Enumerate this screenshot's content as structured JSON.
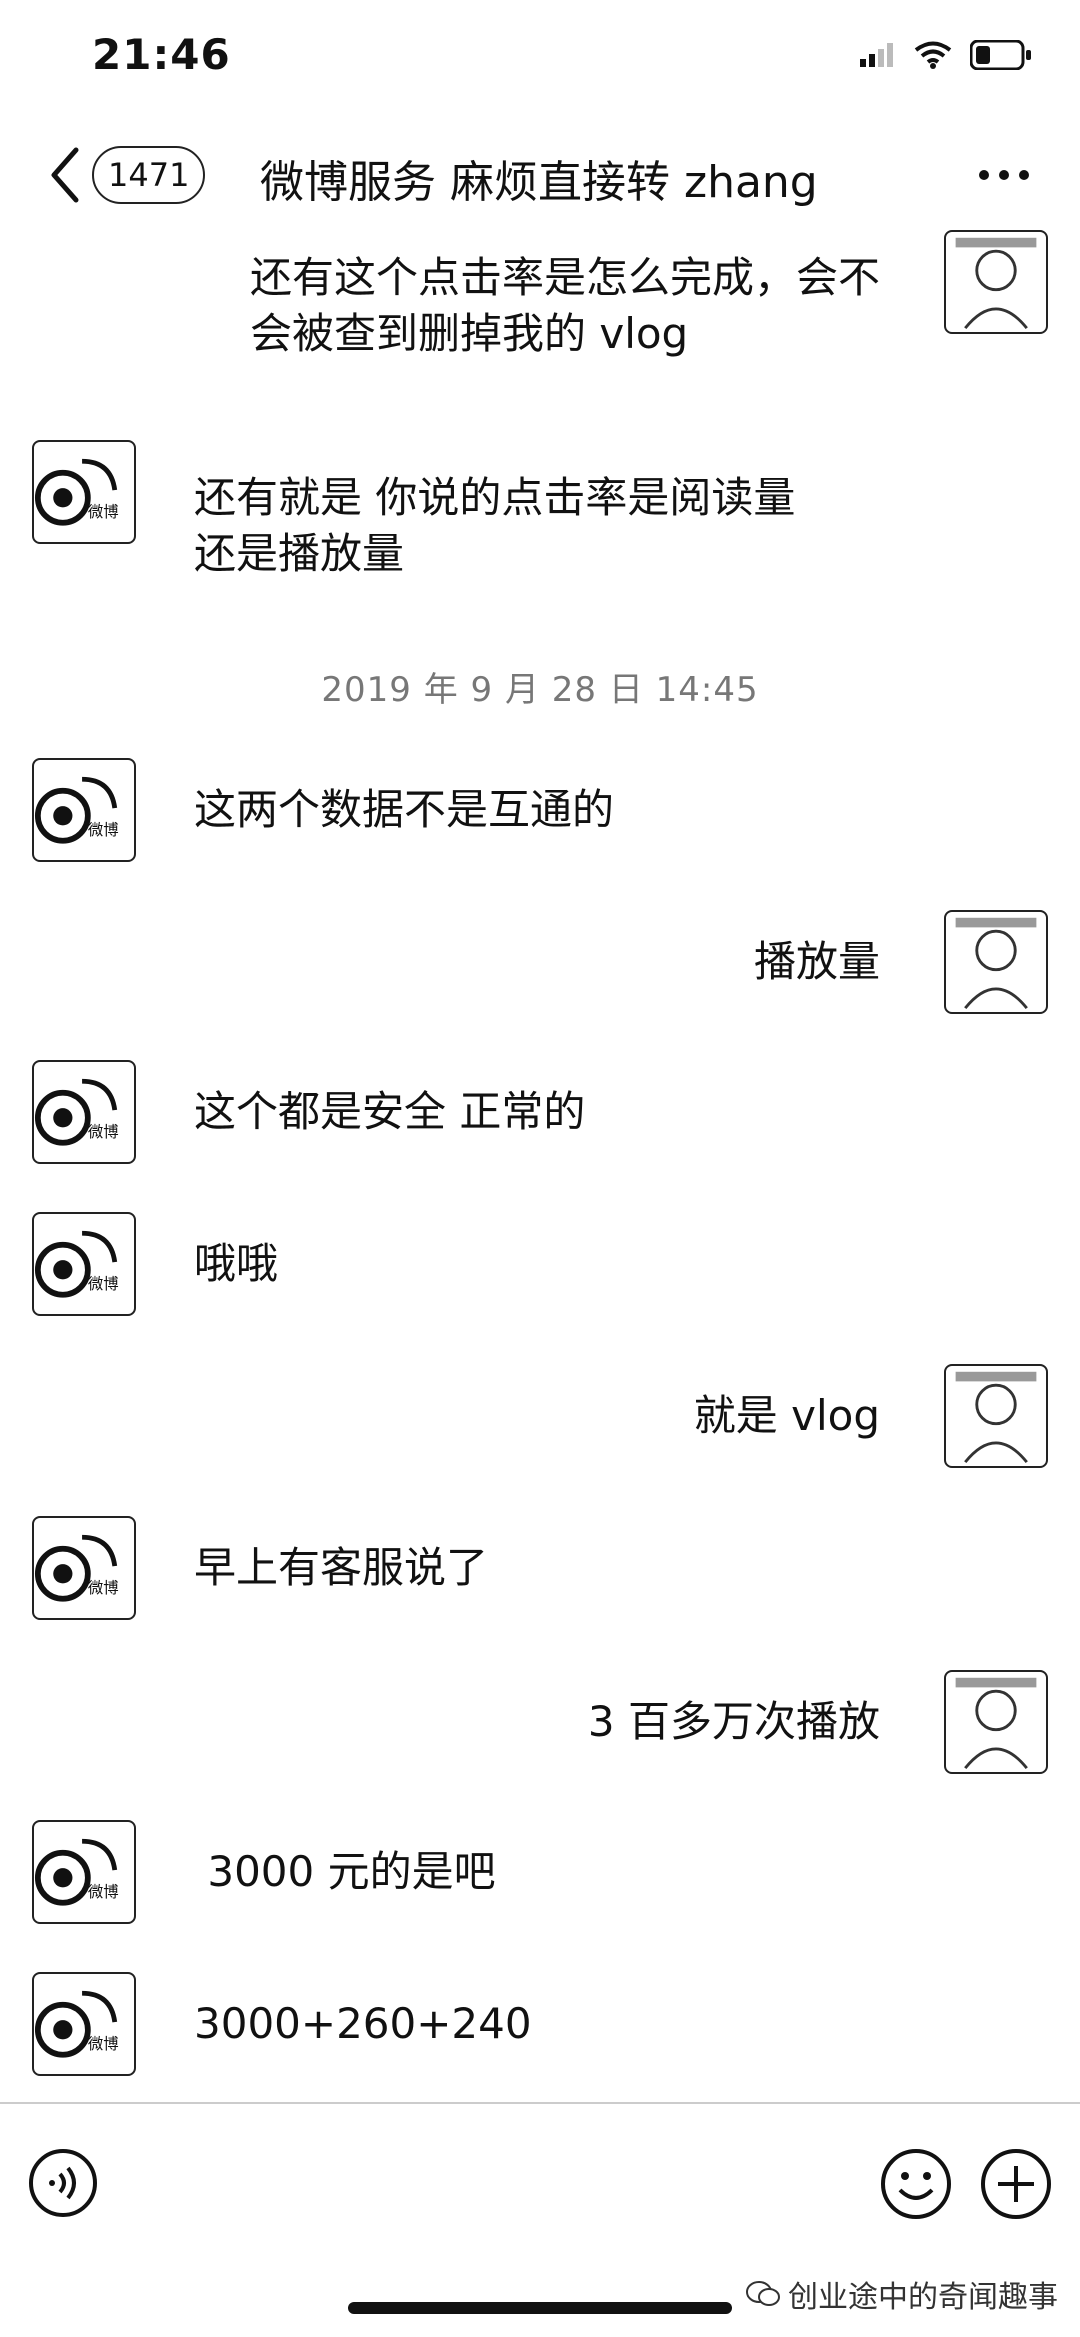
{
  "status_bar": {
    "time": "21:46"
  },
  "nav": {
    "unread_count": "1471",
    "title": "微博服务 麻烦直接转 zhang"
  },
  "messages": [
    {
      "side": "out",
      "text": "还有这个点击率是怎么完成，会不\n会被查到删掉我的 vlog"
    },
    {
      "side": "in",
      "text": "还有就是 你说的点击率是阅读量\n还是播放量"
    },
    {
      "side": "in",
      "text": "这两个数据不是互通的"
    },
    {
      "side": "out",
      "text": "播放量"
    },
    {
      "side": "in",
      "text": "这个都是安全 正常的"
    },
    {
      "side": "in",
      "text": "哦哦"
    },
    {
      "side": "out",
      "text": "就是 vlog"
    },
    {
      "side": "in",
      "text": "早上有客服说了"
    },
    {
      "side": "out",
      "text": "3 百多万次播放"
    },
    {
      "side": "in",
      "text": " 3000 元的是吧"
    },
    {
      "side": "in",
      "text": "3000+260+240"
    }
  ],
  "timestamp": "2019 年 9 月 28 日 14:45",
  "input_bar": {
    "voice_icon": "voice-icon",
    "emoji_icon": "emoji-icon",
    "plus_icon": "plus-icon"
  },
  "watermark": {
    "text": "创业途中的奇闻趣事",
    "icon": "wechat-icon"
  },
  "icons": {
    "back": "chevron-left-icon",
    "more": "more-icon",
    "signal": "signal-icon",
    "wifi": "wifi-icon",
    "battery": "battery-icon"
  }
}
